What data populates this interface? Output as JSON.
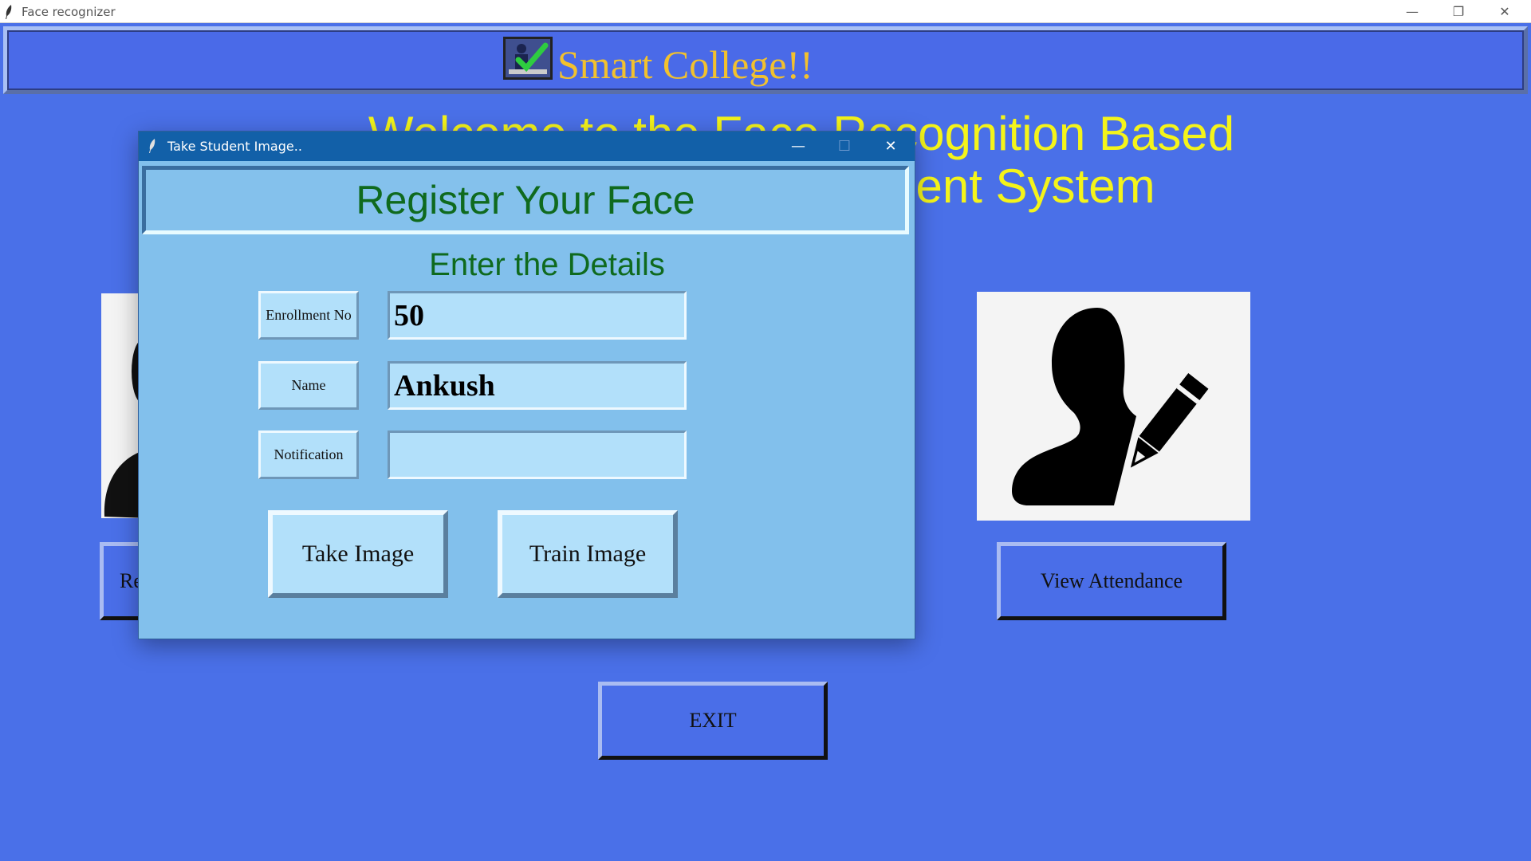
{
  "window": {
    "title": "Face recognizer",
    "minimize": "—",
    "restore": "❐",
    "close": "✕"
  },
  "header": {
    "title": "Smart College!!"
  },
  "welcome": {
    "line1": "Welcome to the Face Recognition Based",
    "line2": "Attendance Management System"
  },
  "main_buttons": {
    "register_partial": "Re",
    "view_attendance": "View Attendance",
    "exit": "EXIT"
  },
  "dialog": {
    "title": "Take Student Image..",
    "minimize": "—",
    "maximize": "☐",
    "close": "✕",
    "heading": "Register Your Face",
    "subheading": "Enter the Details",
    "fields": {
      "enrollment_label": "Enrollment No",
      "enrollment_value": "50",
      "name_label": "Name",
      "name_value": "Ankush",
      "notification_label": "Notification",
      "notification_value": ""
    },
    "take_image": "Take Image",
    "train_image": "Train Image"
  },
  "colors": {
    "background": "#4a70e8",
    "title_gold": "#f2c12e",
    "welcome_yellow": "#f4f41a",
    "dialog_bg": "#82c0ec",
    "dialog_titlebar": "#1260a8",
    "heading_green": "#0f6a1e",
    "field_bg": "#b2e0fa"
  },
  "icons": [
    "feather-icon",
    "attendance-logo-icon",
    "user-edit-icon",
    "user-silhouette-icon"
  ]
}
